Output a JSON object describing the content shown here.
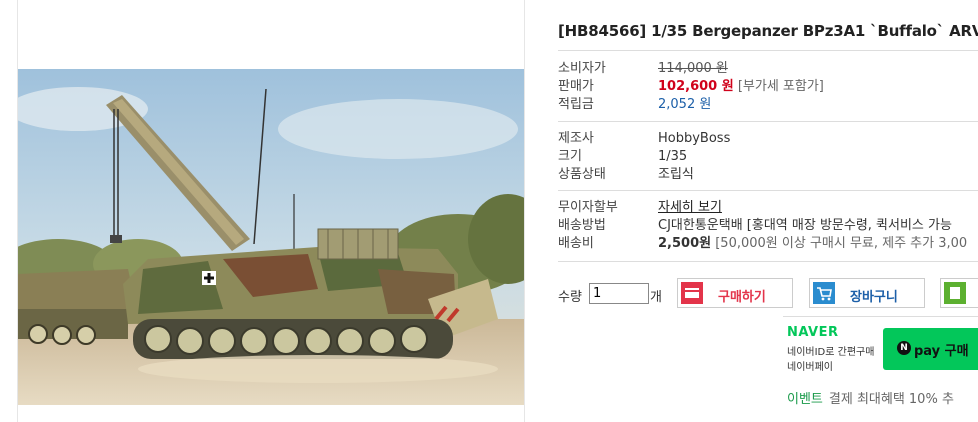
{
  "product": {
    "title": "[HB84566] 1/35 Bergepanzer BPz3A1 `Buffalo` ARV"
  },
  "price_block": {
    "consumer_price_label": "소비자가",
    "consumer_price": "114,000 원",
    "sale_price_label": "판매가",
    "sale_price": "102,600 원",
    "vat_note": "[부가세 포함가]",
    "points_label": "적립금",
    "points": "2,052 원"
  },
  "info_block": {
    "maker_label": "제조사",
    "maker": "HobbyBoss",
    "size_label": "크기",
    "size": "1/35",
    "condition_label": "상품상태",
    "condition": "조립식"
  },
  "shipping_block": {
    "installment_label": "무이자할부",
    "installment_link": "자세히 보기",
    "method_label": "배송방법",
    "method": "CJ대한통운택배 [홍대역 매장 방문수령, 퀵서비스 가능",
    "fee_label": "배송비",
    "fee": "2,500원",
    "fee_note": "[50,000원 이상 구매시 무료, 제주 추가 3,00"
  },
  "order": {
    "qty_label": "수량",
    "qty_value": "1",
    "qty_unit": "개",
    "buy_label": "구매하기",
    "cart_label": "장바구니"
  },
  "naver": {
    "logo": "NAVER",
    "line1": "네이버ID로 간편구매",
    "line2": "네이버페이",
    "pay_label": "pay 구매"
  },
  "event": {
    "tag": "이벤트",
    "text": "결제 최대혜택 10% 추"
  },
  "colors": {
    "sale_price": "#d0021b",
    "points": "#1c5fa8",
    "naver_green": "#03c75a",
    "buy_icon": "#e3344a",
    "cart_icon": "#2a8ccf",
    "wish_icon": "#5cb030"
  }
}
